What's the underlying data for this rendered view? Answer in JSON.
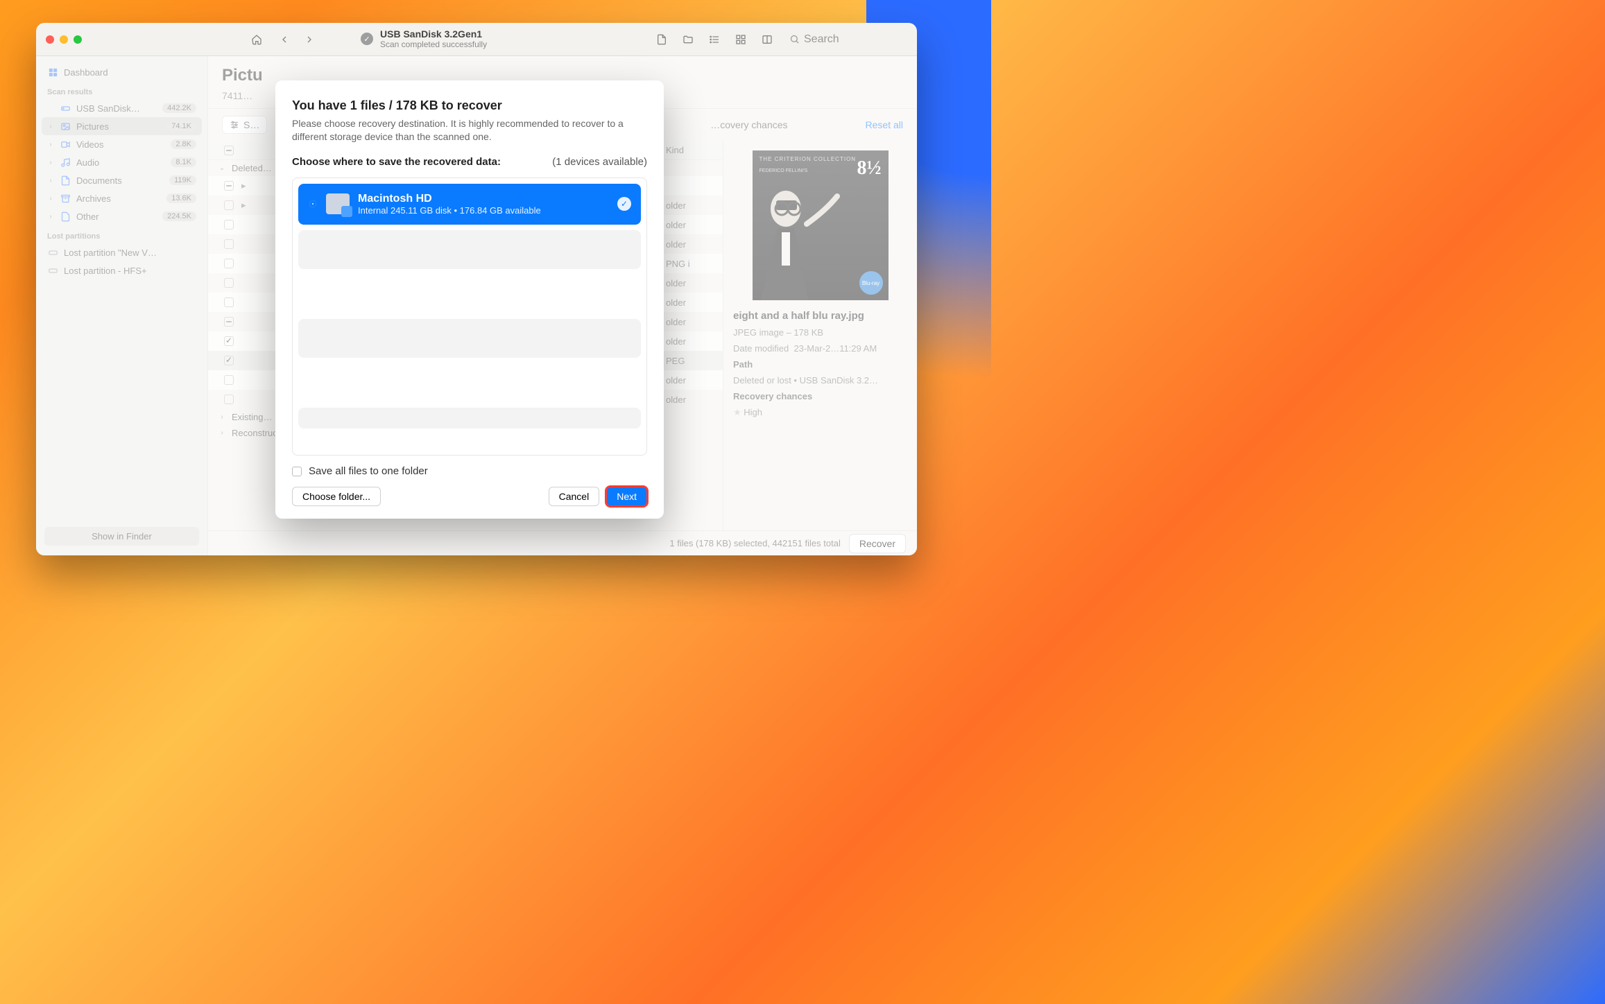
{
  "titlebar": {
    "title": "USB  SanDisk 3.2Gen1",
    "subtitle": "Scan completed successfully",
    "search_placeholder": "Search"
  },
  "sidebar": {
    "dashboard": "Dashboard",
    "section_scan": "Scan results",
    "items": [
      {
        "label": "USB  SanDisk…",
        "badge": "442.2K",
        "icon": "drive"
      },
      {
        "label": "Pictures",
        "badge": "74.1K",
        "icon": "picture",
        "selected": true
      },
      {
        "label": "Videos",
        "badge": "2.8K",
        "icon": "video"
      },
      {
        "label": "Audio",
        "badge": "8.1K",
        "icon": "audio"
      },
      {
        "label": "Documents",
        "badge": "119K",
        "icon": "doc"
      },
      {
        "label": "Archives",
        "badge": "13.6K",
        "icon": "archive"
      },
      {
        "label": "Other",
        "badge": "224.5K",
        "icon": "other"
      }
    ],
    "section_lost": "Lost partitions",
    "lost": [
      {
        "label": "Lost partition \"New V…"
      },
      {
        "label": "Lost partition - HFS+"
      }
    ],
    "show_in_finder": "Show in Finder"
  },
  "main": {
    "heading": "Pictures",
    "subheading_prefix": "7411…",
    "filter_label": "S…",
    "recovery_chances": "…covery chances",
    "reset": "Reset all"
  },
  "table": {
    "kind_header": "Kind",
    "group_deleted": "Deleted…",
    "rows": [
      {
        "state": "ind",
        "kind": ""
      },
      {
        "state": "off",
        "kind": "older"
      },
      {
        "state": "off",
        "kind": "older"
      },
      {
        "state": "off",
        "kind": "older"
      },
      {
        "state": "off",
        "kind": "PNG i"
      },
      {
        "state": "off",
        "kind": "older"
      },
      {
        "state": "off",
        "kind": "older"
      },
      {
        "state": "ind",
        "kind": "older"
      },
      {
        "state": "chk",
        "kind": "older"
      },
      {
        "state": "chk",
        "kind": "PEG"
      },
      {
        "state": "off",
        "kind": "older"
      },
      {
        "state": "off",
        "kind": "older"
      }
    ],
    "group_existing": "Existing…",
    "group_recon": "Reconstructed…"
  },
  "preview": {
    "poster_number": "8½",
    "bd_label": "Blu-ray",
    "filename": "eight and a half blu ray.jpg",
    "meta": "JPEG image – 178 KB",
    "date_label": "Date modified",
    "date_value": "23-Mar-2…11:29 AM",
    "path_label": "Path",
    "path_value": "Deleted or lost • USB  SanDisk 3.2…",
    "chances_label": "Recovery chances",
    "chances_value": "High"
  },
  "statusbar": {
    "summary": "1 files (178 KB) selected, 442151 files total",
    "recover": "Recover"
  },
  "modal": {
    "title": "You have 1 files / 178 KB to recover",
    "desc": "Please choose recovery destination. It is highly recommended to recover to a different storage device than the scanned one.",
    "choose_label": "Choose where to save the recovered data:",
    "devices_available": "(1 devices available)",
    "device": {
      "name": "Macintosh HD",
      "sub": "Internal 245.11 GB disk • 176.84 GB available"
    },
    "save_all": "Save all files to one folder",
    "choose_folder": "Choose folder...",
    "cancel": "Cancel",
    "next": "Next"
  }
}
